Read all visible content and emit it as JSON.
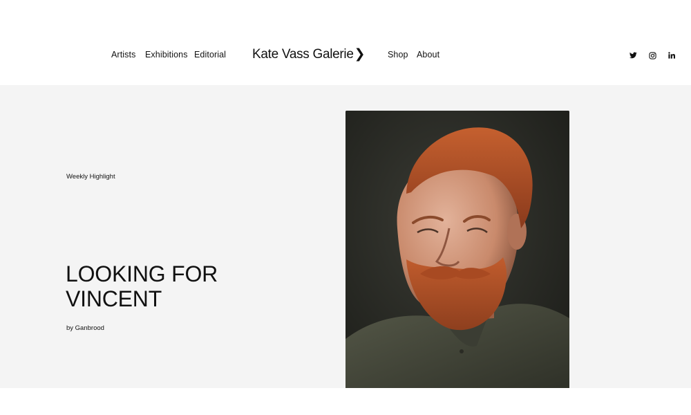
{
  "nav": {
    "left": [
      "Artists",
      "Exhibitions",
      "Editorial"
    ],
    "logo": "Kate Vass Galerie",
    "logo_chevron": "❯",
    "right": [
      "Shop",
      "About"
    ],
    "social_icons": [
      "twitter-icon",
      "instagram-icon",
      "linkedin-icon"
    ]
  },
  "highlight": {
    "kicker": "Weekly Highlight",
    "title_line1": "LOOKING FOR",
    "title_line2": "VINCENT",
    "byline": "by Ganbrood"
  },
  "colors": {
    "hero_bg": "#f4f4f4",
    "text": "#111111",
    "portrait_bg": "#262722",
    "hair": "#b5522a",
    "shirt": "#4a4d3e"
  }
}
